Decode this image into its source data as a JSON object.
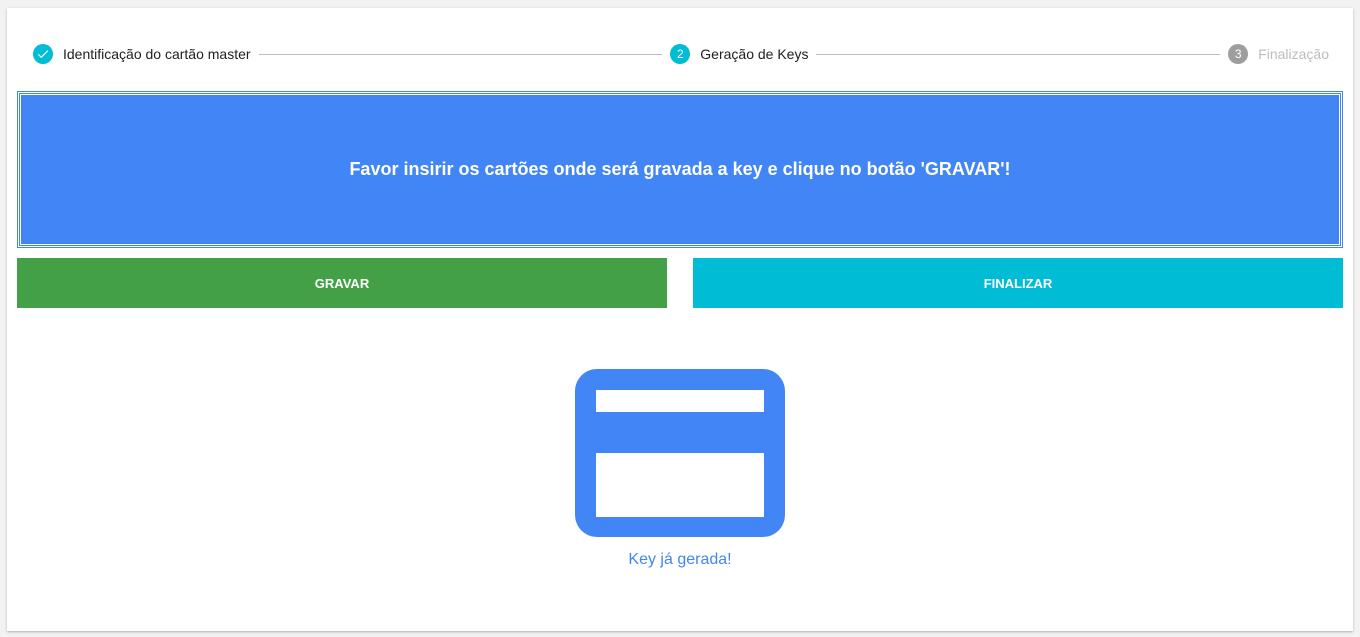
{
  "stepper": {
    "steps": [
      {
        "number": "",
        "label": "Identificação do cartão master",
        "state": "completed",
        "icon": "check-icon"
      },
      {
        "number": "2",
        "label": "Geração de Keys",
        "state": "active"
      },
      {
        "number": "3",
        "label": "Finalização",
        "state": "pending"
      }
    ]
  },
  "banner": {
    "message": "Favor insirir os cartões onde será gravada a key e clique no botão 'GRAVAR'!"
  },
  "actions": {
    "gravar_label": "GRAVAR",
    "finalizar_label": "FINALIZAR"
  },
  "status": {
    "icon": "credit-card-icon",
    "text": "Key já gerada!"
  },
  "colors": {
    "primary_blue": "#4285f4",
    "teal": "#00bcd4",
    "green": "#43a047",
    "gray_step": "#9e9e9e",
    "text_dark": "#212121",
    "text_disabled": "#bdbdbd"
  }
}
